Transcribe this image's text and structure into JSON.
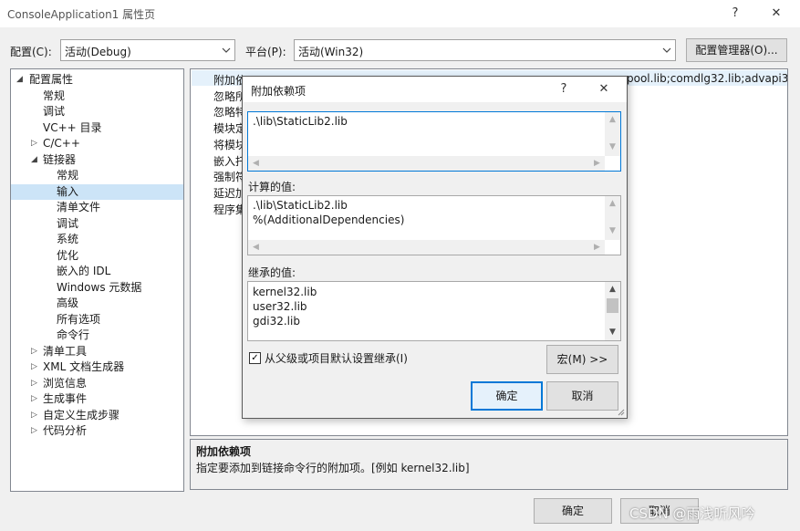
{
  "window": {
    "title": "ConsoleApplication1 属性页",
    "help_glyph": "?",
    "close_glyph": "✕"
  },
  "config": {
    "config_label": "配置(C):",
    "config_value": "活动(Debug)",
    "platform_label": "平台(P):",
    "platform_value": "活动(Win32)",
    "manager_button": "配置管理器(O)..."
  },
  "tree": {
    "items": [
      {
        "label": "配置属性",
        "expander": "◢",
        "level": 0
      },
      {
        "label": "常规",
        "expander": "",
        "level": 1
      },
      {
        "label": "调试",
        "expander": "",
        "level": 1
      },
      {
        "label": "VC++ 目录",
        "expander": "",
        "level": 1
      },
      {
        "label": "C/C++",
        "expander": "▷",
        "level": 1
      },
      {
        "label": "链接器",
        "expander": "◢",
        "level": 1
      },
      {
        "label": "常规",
        "expander": "",
        "level": 2
      },
      {
        "label": "输入",
        "expander": "",
        "level": 2,
        "selected": true
      },
      {
        "label": "清单文件",
        "expander": "",
        "level": 2
      },
      {
        "label": "调试",
        "expander": "",
        "level": 2
      },
      {
        "label": "系统",
        "expander": "",
        "level": 2
      },
      {
        "label": "优化",
        "expander": "",
        "level": 2
      },
      {
        "label": "嵌入的 IDL",
        "expander": "",
        "level": 2
      },
      {
        "label": "Windows 元数据",
        "expander": "",
        "level": 2
      },
      {
        "label": "高级",
        "expander": "",
        "level": 2
      },
      {
        "label": "所有选项",
        "expander": "",
        "level": 2
      },
      {
        "label": "命令行",
        "expander": "",
        "level": 2
      },
      {
        "label": "清单工具",
        "expander": "▷",
        "level": 1
      },
      {
        "label": "XML 文档生成器",
        "expander": "▷",
        "level": 1
      },
      {
        "label": "浏览信息",
        "expander": "▷",
        "level": 1
      },
      {
        "label": "生成事件",
        "expander": "▷",
        "level": 1
      },
      {
        "label": "自定义生成步骤",
        "expander": "▷",
        "level": 1
      },
      {
        "label": "代码分析",
        "expander": "▷",
        "level": 1
      }
    ]
  },
  "grid": {
    "rows": [
      "附加依",
      "忽略所",
      "忽略特",
      "模块定",
      "将模块",
      "嵌入托",
      "强制符",
      "延迟加",
      "程序集"
    ],
    "first_value": "pool.lib;comdlg32.lib;advapi32"
  },
  "description": {
    "title": "附加依赖项",
    "text": "指定要添加到链接命令行的附加项。[例如 kernel32.lib]"
  },
  "buttons": {
    "ok": "确定",
    "cancel": "取消"
  },
  "watermark": "CSDN @雨浅听风吟",
  "dialog": {
    "title": "附加依赖项",
    "help_glyph": "?",
    "close_glyph": "✕",
    "edit_value": ".\\lib\\StaticLib2.lib",
    "computed_label": "计算的值:",
    "computed_lines": [
      ".\\lib\\StaticLib2.lib",
      "%(AdditionalDependencies)"
    ],
    "inherited_label": "继承的值:",
    "inherited_lines": [
      "kernel32.lib",
      "user32.lib",
      "gdi32.lib"
    ],
    "inherit_checkbox": {
      "label": "从父级或项目默认设置继承(I)",
      "checked": true
    },
    "macro_button": "宏(M) >>",
    "ok_button": "确定",
    "cancel_button": "取消"
  },
  "icons": {
    "up": "▲",
    "down": "▼",
    "left": "◀",
    "right": "▶",
    "checkmark": "✓"
  }
}
